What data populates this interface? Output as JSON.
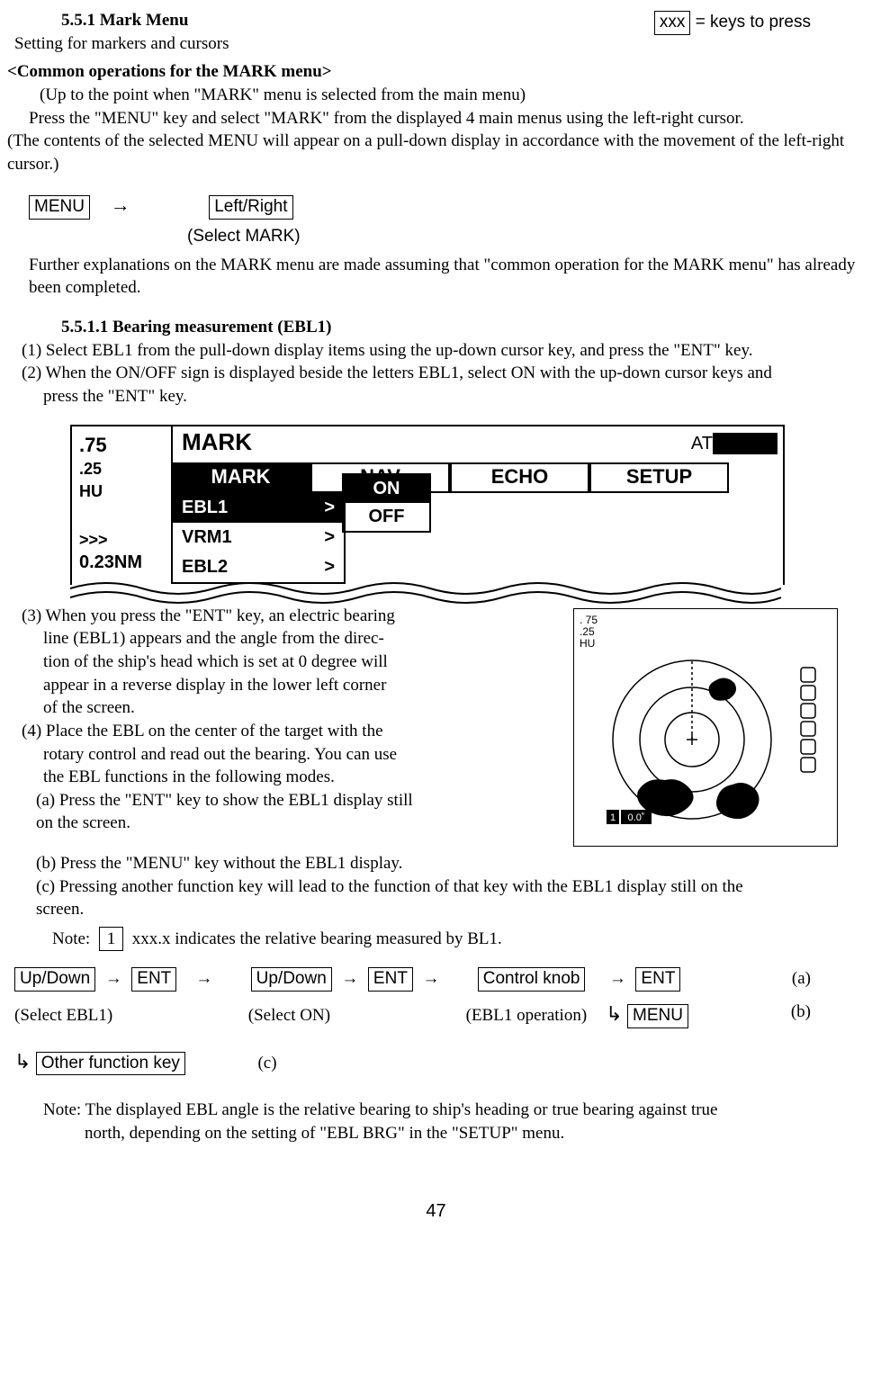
{
  "header": {
    "section_number": "5.5.1 Mark Menu",
    "keys_tip_box": "xxx",
    "keys_tip_text": "= keys to press",
    "subtitle": "Setting for markers and cursors"
  },
  "common_ops": {
    "heading": "<Common operations for the MARK menu>",
    "line1": "(Up to the point when \"MARK\" menu is selected from the main menu)",
    "line2": "Press the \"MENU\" key and select \"MARK\" from the displayed 4 main menus using the left-right cursor.",
    "line3": "(The contents of the selected MENU will appear on a pull-down display in accordance with the movement of the left-right cursor.)"
  },
  "seq1": {
    "k1": "MENU",
    "arrow": "→",
    "k2": "Left/Right",
    "select": "(Select MARK)"
  },
  "further": "Further explanations on the MARK menu are made assuming that \"common operation for the MARK menu\" has already been completed.",
  "sub": {
    "heading": "5.5.1.1 Bearing measurement (EBL1)",
    "item1": "(1)  Select EBL1 from the pull-down display items using the up-down cursor key, and press the \"ENT\" key.",
    "item2a": "(2)  When the ON/OFF sign is displayed beside the letters EBL1, select ON with the up-down cursor keys and",
    "item2b": "press the \"ENT\" key."
  },
  "menu_mock": {
    "range": ".75",
    "sub1": ".25",
    "sub2": "HU",
    "chev": ">>>",
    "nm": "0.23NM",
    "title": "MARK",
    "at": "AT",
    "tabs": [
      "MARK",
      "NAV",
      "ECHO",
      "SETUP"
    ],
    "dropdown": [
      {
        "label": "EBL1",
        "mark": ">"
      },
      {
        "label": "VRM1",
        "mark": ">"
      },
      {
        "label": "EBL2",
        "mark": ">"
      }
    ],
    "onoff": [
      "ON",
      "OFF"
    ]
  },
  "item3": {
    "l1": "(3)  When you press the \"ENT\" key, an electric bearing",
    "l2": "line (EBL1) appears and the angle from the direc-",
    "l3": "tion of the ship's head which is set at 0 degree will",
    "l4": "appear in a reverse display in the lower left corner",
    "l5": "of the screen."
  },
  "item4": {
    "l1": "(4)  Place the EBL on the center of the target with the",
    "l2": "rotary control and read out the bearing. You can use",
    "l3": "the EBL functions in the following modes.",
    "a": "(a)  Press the \"ENT\" key to show the EBL1 display still",
    "a2": "on the screen.",
    "b": "(b)  Press the \"MENU\" key without the EBL1 display.",
    "c": "(c)  Pressing another function key will lead to the function of that key with the EBL1 display still on the",
    "c2": "screen."
  },
  "radar": {
    "r1": ". 75",
    "r2": ".25",
    "r3": "HU",
    "tag1": "1",
    "deg": "0.0˚"
  },
  "note1": {
    "label": "Note:",
    "box": "1",
    "text": "xxx.x indicates the relative bearing measured by BL1."
  },
  "flow": {
    "k_updown": "Up/Down",
    "k_ent": "ENT",
    "k_ctrl": "Control knob",
    "k_menu": "MENU",
    "k_other": "Other function key",
    "arrow": "→",
    "sel_ebl1": "(Select EBL1)",
    "sel_on": "(Select ON)",
    "ebl_op": "(EBL1 operation)",
    "a": "(a)",
    "b": "(b)",
    "c": "(c)"
  },
  "note2": {
    "l1": "Note: The displayed EBL angle is the relative bearing to ship's heading or true bearing against true",
    "l2": "north, depending on the setting of \"EBL BRG\" in the \"SETUP\" menu."
  },
  "page": "47"
}
